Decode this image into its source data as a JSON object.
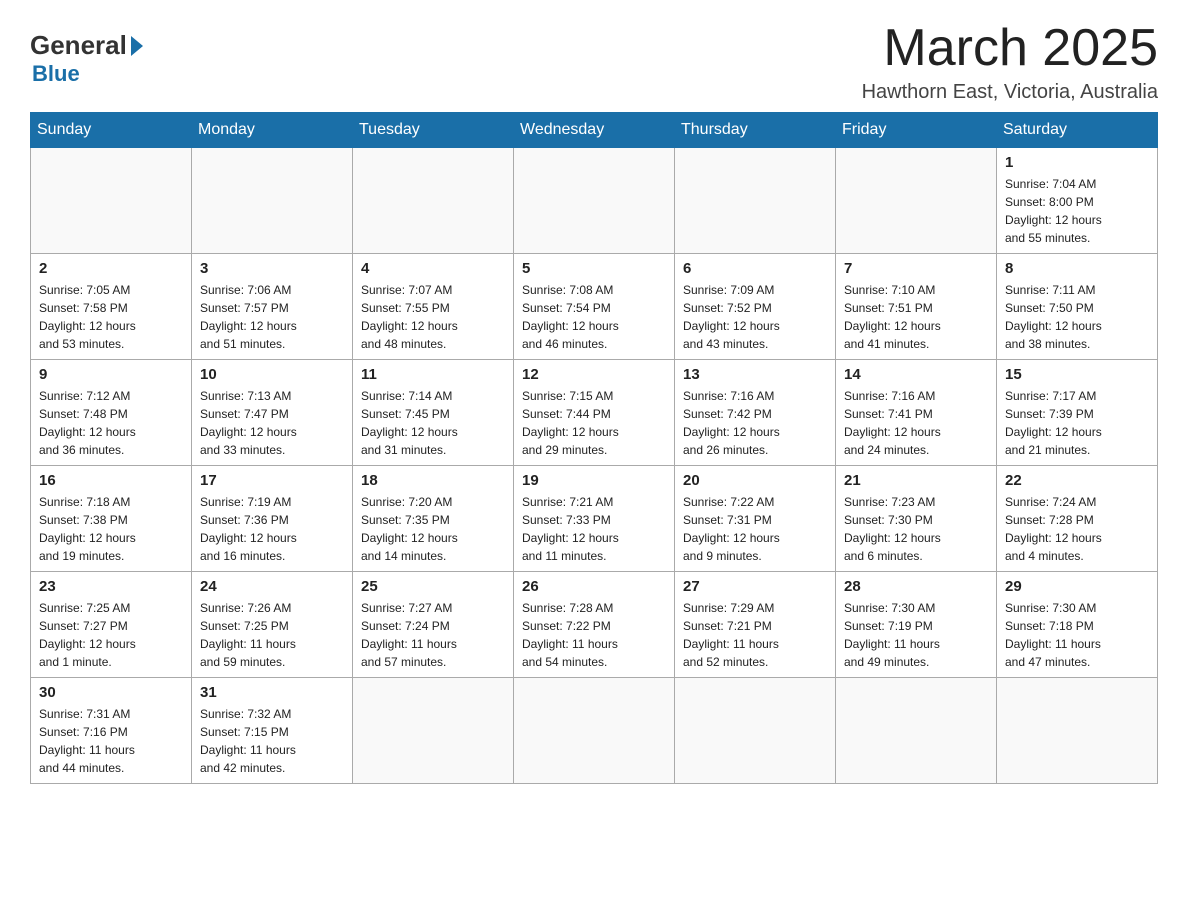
{
  "header": {
    "logo_general": "General",
    "logo_blue": "Blue",
    "month_title": "March 2025",
    "location": "Hawthorn East, Victoria, Australia"
  },
  "weekdays": [
    "Sunday",
    "Monday",
    "Tuesday",
    "Wednesday",
    "Thursday",
    "Friday",
    "Saturday"
  ],
  "weeks": [
    [
      {
        "day": "",
        "info": ""
      },
      {
        "day": "",
        "info": ""
      },
      {
        "day": "",
        "info": ""
      },
      {
        "day": "",
        "info": ""
      },
      {
        "day": "",
        "info": ""
      },
      {
        "day": "",
        "info": ""
      },
      {
        "day": "1",
        "info": "Sunrise: 7:04 AM\nSunset: 8:00 PM\nDaylight: 12 hours\nand 55 minutes."
      }
    ],
    [
      {
        "day": "2",
        "info": "Sunrise: 7:05 AM\nSunset: 7:58 PM\nDaylight: 12 hours\nand 53 minutes."
      },
      {
        "day": "3",
        "info": "Sunrise: 7:06 AM\nSunset: 7:57 PM\nDaylight: 12 hours\nand 51 minutes."
      },
      {
        "day": "4",
        "info": "Sunrise: 7:07 AM\nSunset: 7:55 PM\nDaylight: 12 hours\nand 48 minutes."
      },
      {
        "day": "5",
        "info": "Sunrise: 7:08 AM\nSunset: 7:54 PM\nDaylight: 12 hours\nand 46 minutes."
      },
      {
        "day": "6",
        "info": "Sunrise: 7:09 AM\nSunset: 7:52 PM\nDaylight: 12 hours\nand 43 minutes."
      },
      {
        "day": "7",
        "info": "Sunrise: 7:10 AM\nSunset: 7:51 PM\nDaylight: 12 hours\nand 41 minutes."
      },
      {
        "day": "8",
        "info": "Sunrise: 7:11 AM\nSunset: 7:50 PM\nDaylight: 12 hours\nand 38 minutes."
      }
    ],
    [
      {
        "day": "9",
        "info": "Sunrise: 7:12 AM\nSunset: 7:48 PM\nDaylight: 12 hours\nand 36 minutes."
      },
      {
        "day": "10",
        "info": "Sunrise: 7:13 AM\nSunset: 7:47 PM\nDaylight: 12 hours\nand 33 minutes."
      },
      {
        "day": "11",
        "info": "Sunrise: 7:14 AM\nSunset: 7:45 PM\nDaylight: 12 hours\nand 31 minutes."
      },
      {
        "day": "12",
        "info": "Sunrise: 7:15 AM\nSunset: 7:44 PM\nDaylight: 12 hours\nand 29 minutes."
      },
      {
        "day": "13",
        "info": "Sunrise: 7:16 AM\nSunset: 7:42 PM\nDaylight: 12 hours\nand 26 minutes."
      },
      {
        "day": "14",
        "info": "Sunrise: 7:16 AM\nSunset: 7:41 PM\nDaylight: 12 hours\nand 24 minutes."
      },
      {
        "day": "15",
        "info": "Sunrise: 7:17 AM\nSunset: 7:39 PM\nDaylight: 12 hours\nand 21 minutes."
      }
    ],
    [
      {
        "day": "16",
        "info": "Sunrise: 7:18 AM\nSunset: 7:38 PM\nDaylight: 12 hours\nand 19 minutes."
      },
      {
        "day": "17",
        "info": "Sunrise: 7:19 AM\nSunset: 7:36 PM\nDaylight: 12 hours\nand 16 minutes."
      },
      {
        "day": "18",
        "info": "Sunrise: 7:20 AM\nSunset: 7:35 PM\nDaylight: 12 hours\nand 14 minutes."
      },
      {
        "day": "19",
        "info": "Sunrise: 7:21 AM\nSunset: 7:33 PM\nDaylight: 12 hours\nand 11 minutes."
      },
      {
        "day": "20",
        "info": "Sunrise: 7:22 AM\nSunset: 7:31 PM\nDaylight: 12 hours\nand 9 minutes."
      },
      {
        "day": "21",
        "info": "Sunrise: 7:23 AM\nSunset: 7:30 PM\nDaylight: 12 hours\nand 6 minutes."
      },
      {
        "day": "22",
        "info": "Sunrise: 7:24 AM\nSunset: 7:28 PM\nDaylight: 12 hours\nand 4 minutes."
      }
    ],
    [
      {
        "day": "23",
        "info": "Sunrise: 7:25 AM\nSunset: 7:27 PM\nDaylight: 12 hours\nand 1 minute."
      },
      {
        "day": "24",
        "info": "Sunrise: 7:26 AM\nSunset: 7:25 PM\nDaylight: 11 hours\nand 59 minutes."
      },
      {
        "day": "25",
        "info": "Sunrise: 7:27 AM\nSunset: 7:24 PM\nDaylight: 11 hours\nand 57 minutes."
      },
      {
        "day": "26",
        "info": "Sunrise: 7:28 AM\nSunset: 7:22 PM\nDaylight: 11 hours\nand 54 minutes."
      },
      {
        "day": "27",
        "info": "Sunrise: 7:29 AM\nSunset: 7:21 PM\nDaylight: 11 hours\nand 52 minutes."
      },
      {
        "day": "28",
        "info": "Sunrise: 7:30 AM\nSunset: 7:19 PM\nDaylight: 11 hours\nand 49 minutes."
      },
      {
        "day": "29",
        "info": "Sunrise: 7:30 AM\nSunset: 7:18 PM\nDaylight: 11 hours\nand 47 minutes."
      }
    ],
    [
      {
        "day": "30",
        "info": "Sunrise: 7:31 AM\nSunset: 7:16 PM\nDaylight: 11 hours\nand 44 minutes."
      },
      {
        "day": "31",
        "info": "Sunrise: 7:32 AM\nSunset: 7:15 PM\nDaylight: 11 hours\nand 42 minutes."
      },
      {
        "day": "",
        "info": ""
      },
      {
        "day": "",
        "info": ""
      },
      {
        "day": "",
        "info": ""
      },
      {
        "day": "",
        "info": ""
      },
      {
        "day": "",
        "info": ""
      }
    ]
  ]
}
